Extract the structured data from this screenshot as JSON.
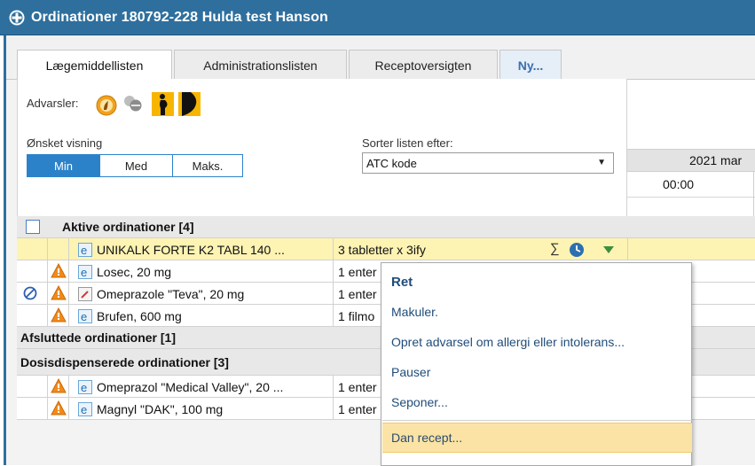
{
  "window": {
    "title": "Ordinationer 180792-228 Hulda test Hanson"
  },
  "tabs": [
    {
      "label": "Lægemiddellisten"
    },
    {
      "label": "Administrationslisten"
    },
    {
      "label": "Receptoversigten"
    },
    {
      "label": "Ny..."
    }
  ],
  "warnings": {
    "label": "Advarsler:",
    "icons": [
      "allergy-warning-icon",
      "interaction-pills-icon",
      "pregnancy-warning-icon",
      "breastfeeding-warning-icon"
    ]
  },
  "view": {
    "label": "Ønsket visning",
    "options": [
      "Min",
      "Med",
      "Maks."
    ],
    "selected": "Min"
  },
  "sort": {
    "label": "Sorter listen efter:",
    "value": "ATC kode"
  },
  "timeline": {
    "date_label": "2021 mar",
    "time_label": "00:00"
  },
  "groups": {
    "active": "Aktive ordinationer [4]",
    "ended": "Afsluttede ordinationer [1]",
    "dosis": "Dosisdispenserede ordinationer [3]"
  },
  "active_rows": [
    {
      "drug": "UNIKALK FORTE K2 TABL 140 ...",
      "dose": "3 tabletter x 3ify"
    },
    {
      "drug": "Losec, 20 mg",
      "dose": "1 enter"
    },
    {
      "drug": "Omeprazole \"Teva\", 20 mg",
      "dose": "1 enter"
    },
    {
      "drug": "Brufen, 600 mg",
      "dose": "1 filmo"
    }
  ],
  "dosis_rows": [
    {
      "drug": "Omeprazol \"Medical Valley\", 20 ...",
      "dose": "1 enter"
    },
    {
      "drug": "Magnyl \"DAK\", 100 mg",
      "dose": "1 enter"
    }
  ],
  "context_menu": {
    "items": [
      "Ret",
      "Makuler.",
      "Opret advarsel om allergi eller intolerans...",
      "Pauser",
      "Seponer...",
      "Dan recept..."
    ]
  },
  "colors": {
    "title_bar": "#2e6f9e",
    "selected_segment": "#2c82c9",
    "highlight_row": "#fdf3b3",
    "menu_highlight": "#fbe3a6"
  }
}
